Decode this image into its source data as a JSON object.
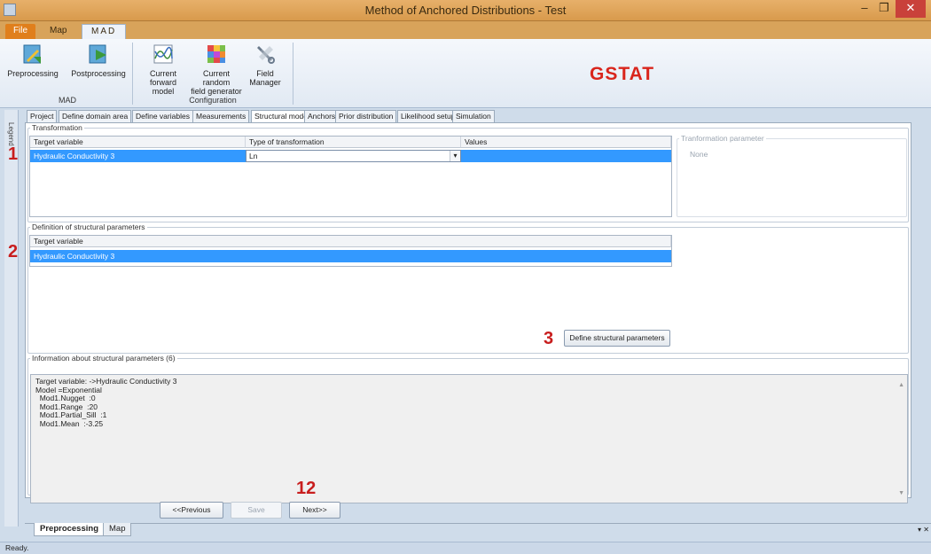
{
  "window": {
    "title": "Method of Anchored Distributions - Test",
    "min": "–",
    "max": "❐",
    "close": "✕"
  },
  "ribbon_tabs": [
    {
      "label": "File"
    },
    {
      "label": "Map"
    },
    {
      "label": "MAD"
    }
  ],
  "ribbon": {
    "buttons": [
      {
        "label1": "Preprocessing",
        "label2": "",
        "icon": "preprocessing-icon"
      },
      {
        "label1": "Postprocessing",
        "label2": "",
        "icon": "postprocessing-icon"
      },
      {
        "label1": "Current",
        "label2": "forward model",
        "icon": "forward-model-icon"
      },
      {
        "label1": "Current random",
        "label2": "field generator",
        "icon": "field-generator-icon"
      },
      {
        "label1": "Field",
        "label2": "Manager",
        "icon": "field-manager-icon"
      }
    ],
    "groups": [
      {
        "label": "MAD"
      },
      {
        "label": "Configuration"
      }
    ],
    "overlay_label": "GSTAT"
  },
  "legend_label": "Legend",
  "main_tabs": [
    {
      "label": "Project"
    },
    {
      "label": "Define domain area"
    },
    {
      "label": "Define variables"
    },
    {
      "label": "Measurements"
    },
    {
      "label": "Structural model"
    },
    {
      "label": "Anchors"
    },
    {
      "label": "Prior distribution"
    },
    {
      "label": "Likelihood setup"
    },
    {
      "label": "Simulation"
    }
  ],
  "active_tab": "Structural model",
  "transformation": {
    "legend": "Transformation",
    "headers": [
      "Target variable",
      "Type of transformation",
      "Values"
    ],
    "row": {
      "target": "Hydraulic Conductivity 3",
      "type": "Ln",
      "values": ""
    },
    "param_legend": "Tranformation parameter",
    "param_value": "None"
  },
  "structural": {
    "legend": "Definition of structural parameters",
    "header": "Target variable",
    "row": "Hydraulic Conductivity 3",
    "define_button": "Define structural parameters"
  },
  "info": {
    "legend": "Information about structural parameters  (6)",
    "text": "Target variable: ->Hydraulic Conductivity 3\nModel =Exponential\n  Mod1.Nugget  :0\n  Mod1.Range  :20\n  Mod1.Partial_Sill  :1\n  Mod1.Mean  :-3.25"
  },
  "annotations": {
    "n1": "1",
    "n2": "2",
    "n3": "3",
    "n12": "12"
  },
  "nav": {
    "previous": "<<Previous",
    "save": "Save",
    "next": "Next>>"
  },
  "bottom_tabs": [
    {
      "label": "Preprocessing"
    },
    {
      "label": "Map"
    }
  ],
  "status": "Ready."
}
